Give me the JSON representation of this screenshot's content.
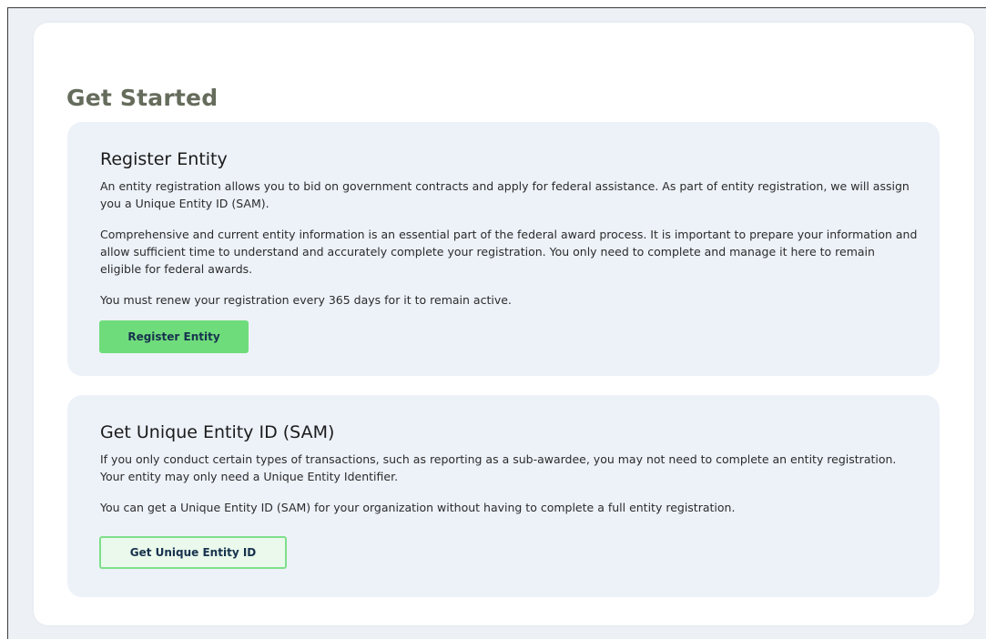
{
  "page": {
    "title": "Get Started"
  },
  "register": {
    "heading": "Register Entity",
    "paragraph1": "An entity registration allows you to bid on government contracts and apply for federal assistance. As part of entity registration, we will assign you a Unique Entity ID (SAM).",
    "paragraph2": "Comprehensive and current entity information is an essential part of the federal award process. It is important to prepare your information and allow sufficient time to understand and accurately complete your registration. You only need to complete and manage it here to remain eligible for federal awards.",
    "paragraph3": "You must renew your registration every 365 days for it to remain active.",
    "button_label": "Register Entity"
  },
  "uei": {
    "heading": "Get Unique Entity ID (SAM)",
    "paragraph1": "If you only conduct certain types of transactions, such as reporting as a sub-awardee, you may not need to complete an entity registration. Your entity may only need a Unique Entity Identifier.",
    "paragraph2": "You can get a Unique Entity ID (SAM) for your organization without having to complete a full entity registration.",
    "button_label": "Get Unique Entity ID"
  },
  "colors": {
    "page_background": "#edf1f6",
    "panel_background": "#edf2f9",
    "primary_button": "#6fdc7c",
    "outline_button_border": "#7fdf8b",
    "title_text": "#656c5c"
  }
}
